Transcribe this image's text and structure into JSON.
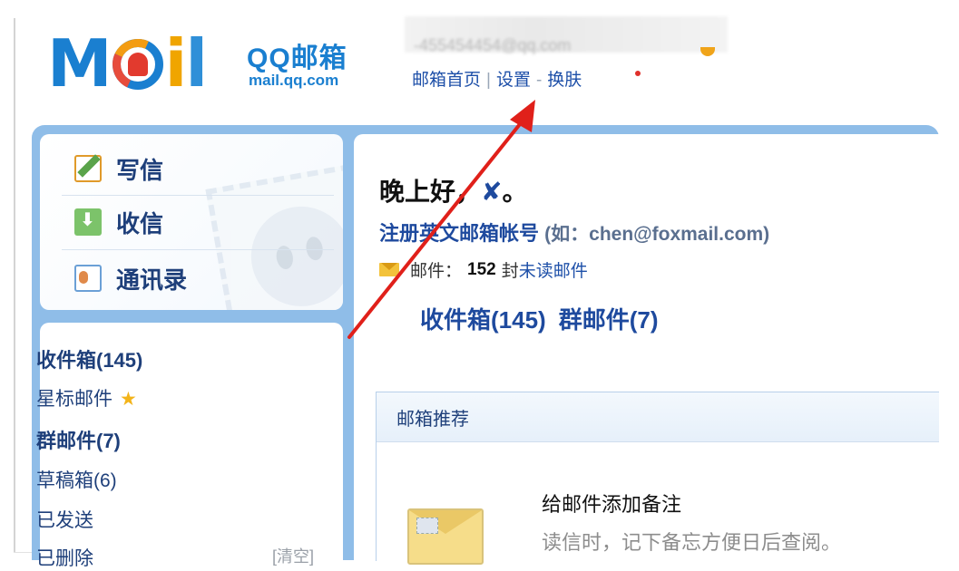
{
  "logo": {
    "wordmark_m": "M",
    "wordmark_rest": "il",
    "brand": "QQ邮箱",
    "url": "mail.qq.com"
  },
  "header": {
    "email_ghost": "-455454454@qq.com",
    "links": [
      "邮箱首页",
      "设置",
      "换肤"
    ],
    "separators": [
      "|",
      "-"
    ]
  },
  "sidebar": {
    "actions": [
      {
        "label": "写信",
        "icon": "pencil-paper-icon"
      },
      {
        "label": "收信",
        "icon": "inbox-download-icon"
      },
      {
        "label": "通讯录",
        "icon": "contact-card-icon"
      }
    ],
    "folders": [
      {
        "label": "收件箱(145)",
        "bold": true
      },
      {
        "label": "星标邮件",
        "bold": false,
        "star": "★"
      },
      {
        "label": "群邮件(7)",
        "bold": true
      },
      {
        "label": "草稿箱(6)",
        "bold": false
      },
      {
        "label": "已发送",
        "bold": false
      },
      {
        "label": "已删除",
        "bold": false
      }
    ],
    "clear_label": "[清空]"
  },
  "main": {
    "greeting": "晚上好，",
    "greeting_name": "✘",
    "greeting_end": "。",
    "register_link": "注册英文邮箱帐号",
    "register_hint": "(如：chen@foxmail.com)",
    "mail_label": "邮件：",
    "mail_count": "152",
    "mail_unit": "封",
    "unread_label": "未读邮件",
    "box_links": [
      "收件箱(145)",
      "群邮件(7)"
    ],
    "recommend": {
      "header": "邮箱推荐",
      "title": "给邮件添加备注",
      "desc": "读信时，记下备忘方便日后查阅。"
    }
  },
  "colors": {
    "brand_blue": "#1a7fd0",
    "frame_blue": "#8fbde8",
    "link_blue": "#1d4fa8",
    "arrow_red": "#e0201a"
  }
}
